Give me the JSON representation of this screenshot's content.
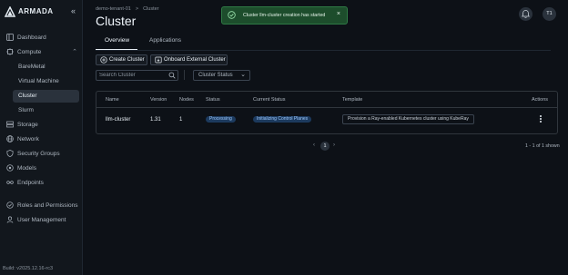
{
  "brand": {
    "name": "ARMADA",
    "collapse_glyph": "«"
  },
  "sidebar": {
    "items": [
      {
        "id": "dashboard",
        "label": "Dashboard",
        "icon": "dashboard-icon"
      },
      {
        "id": "compute",
        "label": "Compute",
        "icon": "compute-icon",
        "expanded": true
      },
      {
        "id": "baremetal",
        "label": "BareMetal",
        "sub": true
      },
      {
        "id": "virtual-machine",
        "label": "Virtual Machine",
        "sub": true
      },
      {
        "id": "cluster",
        "label": "Cluster",
        "sub": true,
        "active": true
      },
      {
        "id": "slurm",
        "label": "Slurm",
        "sub": true
      },
      {
        "id": "storage",
        "label": "Storage",
        "icon": "storage-icon"
      },
      {
        "id": "network",
        "label": "Network",
        "icon": "network-icon"
      },
      {
        "id": "security-groups",
        "label": "Security Groups",
        "icon": "shield-icon"
      },
      {
        "id": "models",
        "label": "Models",
        "icon": "models-icon"
      },
      {
        "id": "endpoints",
        "label": "Endpoints",
        "icon": "endpoints-icon"
      },
      {
        "id": "roles",
        "label": "Roles and Permissions",
        "icon": "roles-icon"
      },
      {
        "id": "user-management",
        "label": "User Management",
        "icon": "user-icon"
      }
    ],
    "build": "Build: v2025.12.16-rc3"
  },
  "header": {
    "breadcrumb": [
      "demo-tenant-01",
      "Cluster"
    ],
    "breadcrumb_sep": ">",
    "title": "Cluster",
    "avatar": "T1"
  },
  "toast": {
    "message": "Cluster llm-cluster creation has started",
    "close": "×",
    "color": "#1d4d2c"
  },
  "tabs": [
    {
      "label": "Overview",
      "active": true
    },
    {
      "label": "Applications",
      "active": false
    }
  ],
  "toolbar": {
    "create_label": "Create Cluster",
    "onboard_label": "Onboard External Cluster",
    "search_placeholder": "Search Cluster",
    "status_filter": "Cluster Status"
  },
  "table": {
    "columns": [
      "Name",
      "Version",
      "Nodes",
      "Status",
      "Current Status",
      "Template",
      "Actions"
    ],
    "rows": [
      {
        "name": "llm-cluster",
        "version": "1.31",
        "nodes": "1",
        "status": "Processing",
        "current_status": "Initializing Control Planes",
        "template": "Provision a Ray-enabled Kubernetes cluster using KubeRay"
      }
    ]
  },
  "pagination": {
    "prev": "‹",
    "page": "1",
    "next": "›",
    "shown_text": "1 - 1 of 1 shown"
  },
  "colors": {
    "background": "#0d1117",
    "sidebar": "#12171d",
    "pill": "#1c3a5e",
    "toast": "#1d4d2c"
  }
}
